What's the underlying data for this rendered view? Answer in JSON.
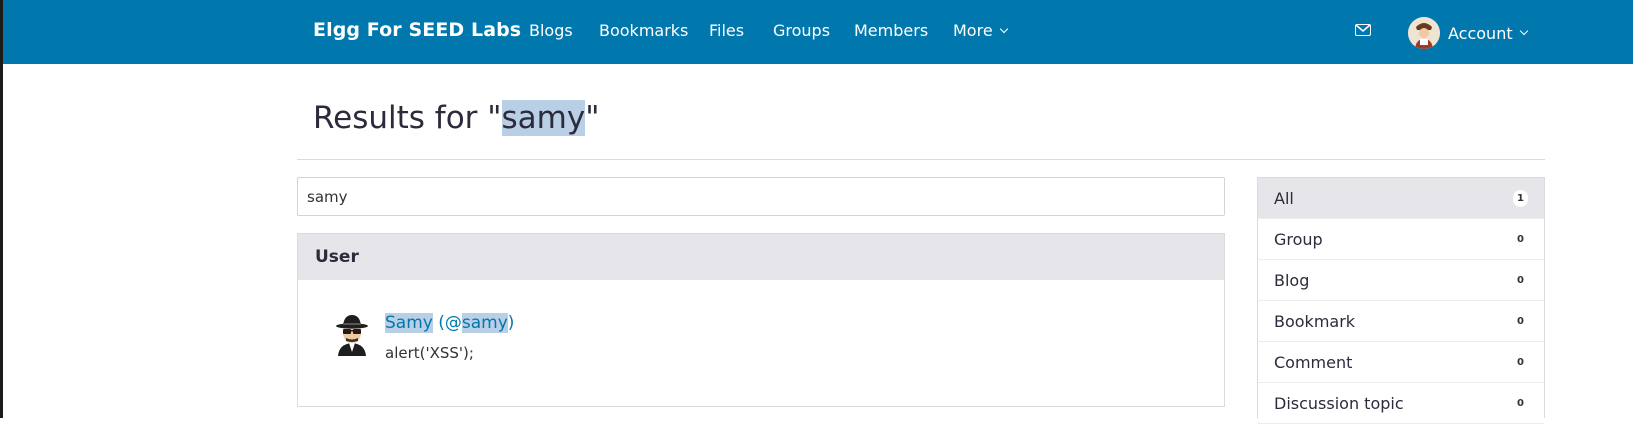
{
  "header": {
    "brand": "Elgg For SEED Labs",
    "nav": {
      "blogs": "Blogs",
      "bookmarks": "Bookmarks",
      "files": "Files",
      "groups": "Groups",
      "members": "Members",
      "more": "More"
    },
    "account": "Account",
    "icons": {
      "mail": "envelope-icon",
      "avatar": "user-avatar"
    }
  },
  "page": {
    "title_prefix": "Results for \"",
    "query": "samy",
    "title_suffix": "\""
  },
  "search": {
    "value": "samy"
  },
  "results": {
    "section_title": "User",
    "items": [
      {
        "name": "Samy",
        "handle_prefix": " (@",
        "handle": "samy",
        "handle_suffix": ")",
        "description": "alert('XSS');"
      }
    ]
  },
  "sidebar": {
    "items": [
      {
        "label": "All",
        "count": "1",
        "active": true
      },
      {
        "label": "Group",
        "count": "0"
      },
      {
        "label": "Blog",
        "count": "0"
      },
      {
        "label": "Bookmark",
        "count": "0"
      },
      {
        "label": "Comment",
        "count": "0"
      },
      {
        "label": "Discussion topic",
        "count": "0"
      }
    ]
  },
  "colors": {
    "topbar": "#0078ae",
    "highlight": "#b8cfe6",
    "link": "#0078ae"
  }
}
